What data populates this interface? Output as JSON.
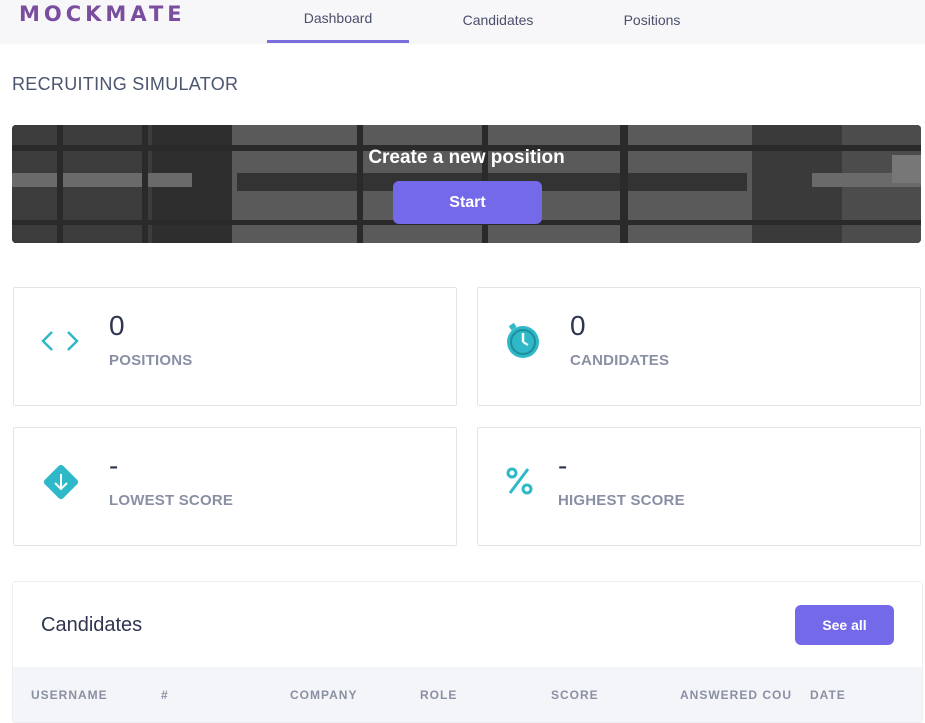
{
  "app": {
    "logo": "MOCKMATE"
  },
  "nav": {
    "tabs": [
      {
        "label": "Dashboard",
        "active": true
      },
      {
        "label": "Candidates",
        "active": false
      },
      {
        "label": "Positions",
        "active": false
      }
    ]
  },
  "page": {
    "title": "RECRUITING SIMULATOR"
  },
  "banner": {
    "title": "Create a new position",
    "button": "Start"
  },
  "stats": [
    {
      "value": "0",
      "label": "POSITIONS",
      "icon": "code-icon"
    },
    {
      "value": "0",
      "label": "CANDIDATES",
      "icon": "stopwatch-icon"
    },
    {
      "value": "-",
      "label": "LOWEST SCORE",
      "icon": "arrow-down-diamond-icon"
    },
    {
      "value": "-",
      "label": "HIGHEST SCORE",
      "icon": "percent-icon"
    }
  ],
  "candidates": {
    "title": "Candidates",
    "see_all": "See all",
    "columns": [
      "USERNAME",
      "#",
      "COMPANY",
      "ROLE",
      "SCORE",
      "ANSWERED COUNT",
      "DATE"
    ]
  },
  "colors": {
    "accent": "#7469e8",
    "icon": "#2fb8c8",
    "logo": "#7b4d9f"
  }
}
